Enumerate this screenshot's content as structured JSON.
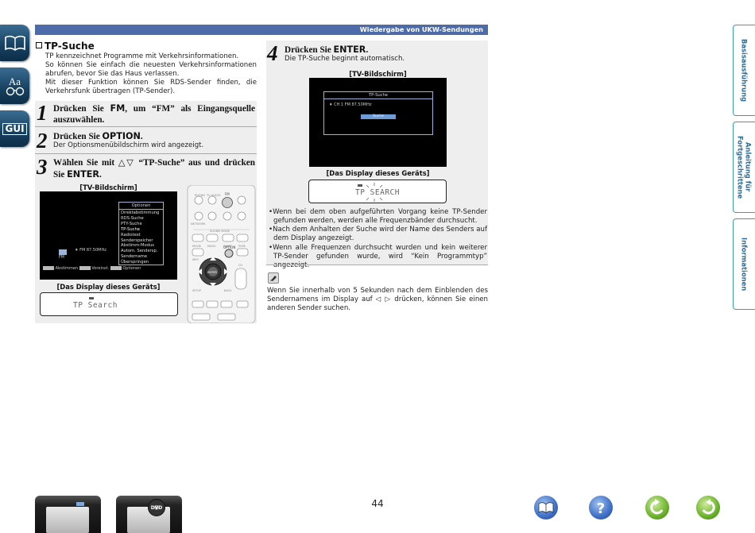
{
  "header": {
    "title": "Wiedergabe von UKW-Sendungen"
  },
  "left_icons": [
    "book-icon",
    "aa-icon",
    "gui-icon"
  ],
  "left_icon_labels": {
    "aa": "Aa",
    "gui": "GUI"
  },
  "section": {
    "title": "TP-Suche",
    "intro": [
      "TP kennzeichnet Programme mit Verkehrsinformationen.",
      "So können Sie einfach die neuesten Verkehrsinformationen abrufen, bevor Sie das Haus verlassen.",
      "Mit dieser Funktion können Sie RDS-Sender finden, die Verkehrsfunk übertragen (TP-Sender)."
    ]
  },
  "steps": [
    {
      "num": "1",
      "pre": "Drücken Sie ",
      "key": "FM",
      "post": ", um “FM” als Eingangsquelle auszuwählen.",
      "sub": ""
    },
    {
      "num": "2",
      "pre": "Drücken Sie ",
      "key": "OPTION",
      "post": ".",
      "sub": "Der Optionsmenübildschirm wird angezeigt."
    },
    {
      "num": "3",
      "pre": "Wählen Sie mit △▽ “TP-Suche” aus und drücken Sie ",
      "key": "ENTER",
      "post": ".",
      "sub": ""
    },
    {
      "num": "4",
      "pre": "Drücken Sie ",
      "key": "ENTER",
      "post": ".",
      "sub": "Die TP-Suche beginnt automatisch."
    }
  ],
  "labels": {
    "tv": "[TV-Bildschirm]",
    "display": "[Das Display dieses Geräts]"
  },
  "tv1": {
    "menu_title": "Optionen",
    "menu_items": [
      "Direktabstimmung",
      "RDS-Suche",
      "PTY-Suche",
      "TP-Suche",
      "Radiotext",
      "Senderspeicher",
      "Abstimm-Modus",
      "Autom. Sendersp.",
      "Sendername",
      "Überspringen"
    ],
    "freq": "FM  87.50MHz",
    "source": "FM",
    "footer": [
      "Abstimmen",
      "Voreinst.",
      "Optionen"
    ]
  },
  "tv2": {
    "box_title": "TP-Suche",
    "freq": "CH 1  FM   87.50MHz",
    "search": "Suche"
  },
  "lcd1": {
    "text": "TP Search"
  },
  "lcd2": {
    "text": "TP SEARCH"
  },
  "remote": {
    "labels": [
      "PHONO",
      "TV AUDIO",
      "FM",
      "NETWORK",
      "SOUND MODE",
      "MOVIE",
      "MUSIC",
      "GAME",
      "PURE",
      "INFO",
      "OPTION",
      "SETUP",
      "BACK",
      "ENTER",
      "CH",
      "TUNE"
    ]
  },
  "bullets": [
    "Wenn bei dem oben aufgeführten Vorgang keine TP-Sender gefunden werden, werden alle Frequenzbänder durchsucht.",
    "Nach dem Anhalten der Suche wird der Name des Senders auf dem Display angezeigt.",
    "Wenn alle Frequenzen durchsucht wurden und kein weiterer TP-Sender gefunden wurde, wird “Kein Programmtyp” angezeigt."
  ],
  "note": {
    "pre": "Wenn Sie innerhalb von 5 Sekunden nach dem Einblenden des Sendernamens im Display auf ",
    "keys": "◁ ▷",
    "post": " drücken, können Sie einen anderen Sender suchen."
  },
  "right_tabs": [
    "Basisausführung",
    "Anleitung für Fortgeschrittene",
    "Informationen"
  ],
  "page_number": "44",
  "nav_icons": [
    "manual-icon",
    "help-icon",
    "back-icon",
    "forward-icon"
  ],
  "device_badge": "DVD"
}
